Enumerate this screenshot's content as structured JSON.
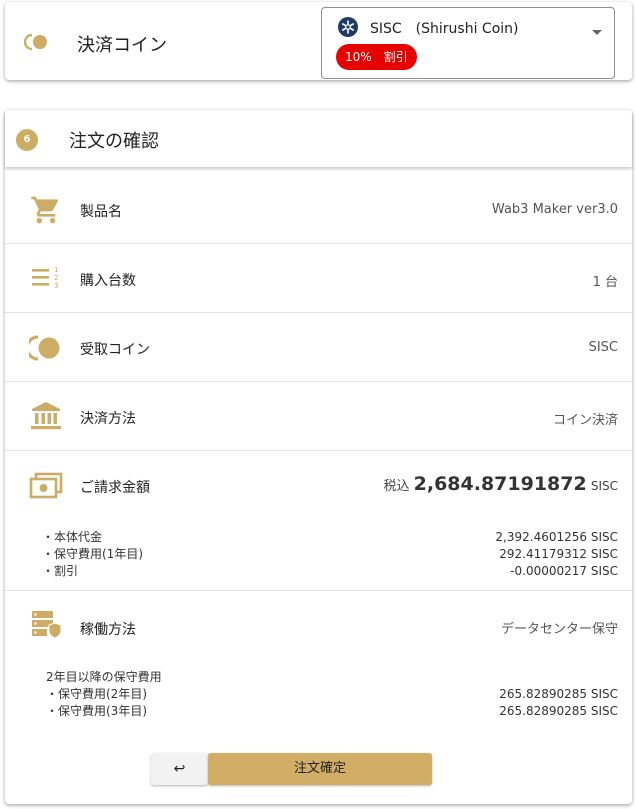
{
  "colors": {
    "accent": "#cdac65",
    "badge": "#e60000",
    "button": "#d2ad65"
  },
  "payment_coin": {
    "label": "決済コイン",
    "icon": "coin-icon",
    "selected": "SISC　(Shirushi Coin)",
    "selected_icon": "sisc-logo-icon",
    "discount_badge": "10%　割引"
  },
  "order_confirmation": {
    "step": "6",
    "title": "注文の確認",
    "rows": {
      "product": {
        "icon": "cart-icon",
        "label": "製品名",
        "value": "Wab3 Maker ver3.0"
      },
      "quantity": {
        "icon": "numbered-list-icon",
        "label": "購入台数",
        "value": "1 台"
      },
      "receive_coin": {
        "icon": "coin-icon",
        "label": "受取コイン",
        "value": "SISC"
      },
      "payment_method": {
        "icon": "bank-icon",
        "label": "決済方法",
        "value": "コイン決済"
      },
      "billing": {
        "icon": "money-icon",
        "label": "ご請求金額",
        "prefix": "税込",
        "amount": "2,684.87191872",
        "unit": "SISC",
        "items": [
          {
            "label": "・本体代金",
            "value": "2,392.4601256 SISC"
          },
          {
            "label": "・保守費用(1年目)",
            "value": "292.41179312 SISC"
          },
          {
            "label": "・割引",
            "value": "-0.00000217 SISC"
          }
        ]
      },
      "operation": {
        "icon": "server-shield-icon",
        "label": "稼働方法",
        "value": "データセンター保守",
        "note": "2年目以降の保守費用",
        "items": [
          {
            "label": "・保守費用(2年目)",
            "value": "265.82890285 SISC"
          },
          {
            "label": "・保守費用(3年目)",
            "value": "265.82890285 SISC"
          }
        ]
      }
    },
    "back_label": "↩",
    "confirm_label": "注文確定"
  }
}
